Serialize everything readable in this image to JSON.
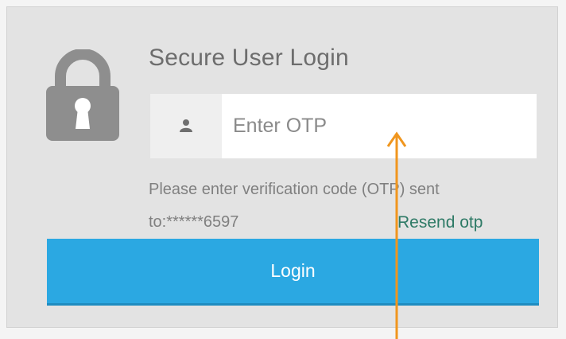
{
  "login": {
    "title": "Secure User Login",
    "otp_placeholder": "Enter OTP",
    "help_line1": "Please enter verification code (OTP) sent",
    "help_line2": "to:******6597",
    "resend_label": "Resend otp",
    "login_label": "Login"
  },
  "icons": {
    "lock": "lock-icon",
    "user": "user-icon",
    "annotation": "arrow-up-icon"
  },
  "colors": {
    "panel_bg": "#e3e3e3",
    "button_bg": "#2ba8e2",
    "link": "#2e7a66",
    "arrow": "#f0961e"
  }
}
